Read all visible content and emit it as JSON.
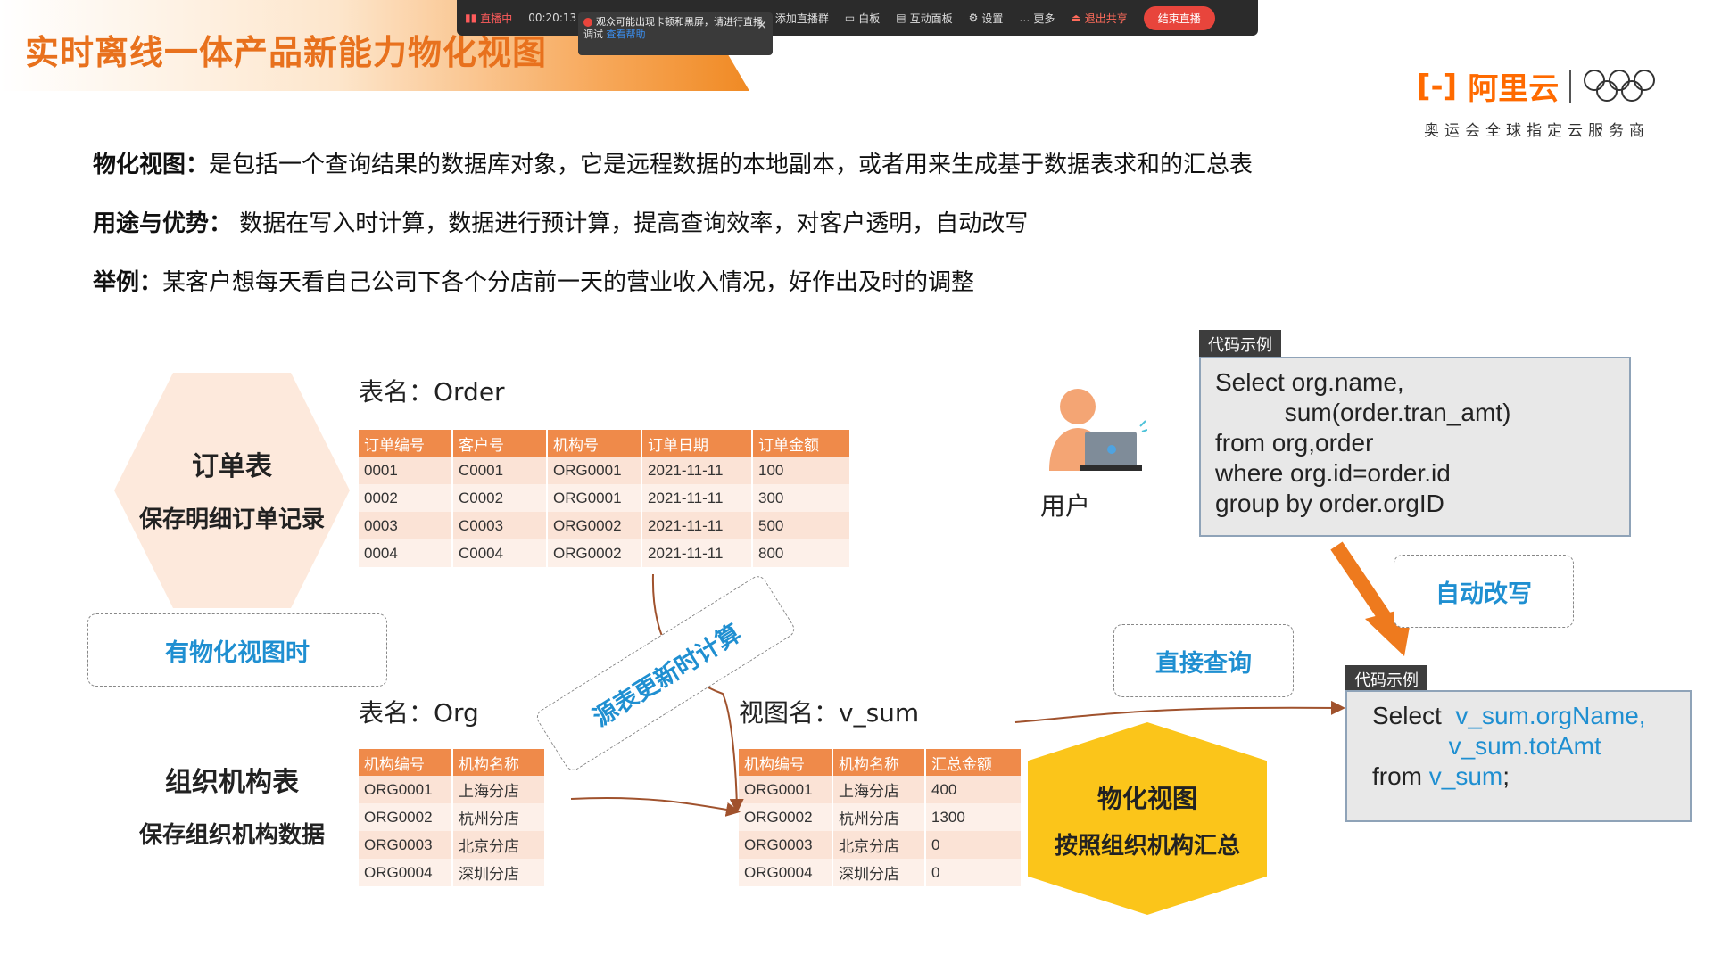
{
  "page": {
    "title": "实时离线一体产品新能力物化视图"
  },
  "toolbar": {
    "live_label": "直播中",
    "timer": "00:20:13",
    "items": [
      "添加直播群",
      "白板",
      "互动面板",
      "设置",
      "更多"
    ],
    "exit_share": "退出共享",
    "end_live": "结束直播"
  },
  "notice": {
    "text": "观众可能出现卡顿和黑屏，请进行直播调试",
    "link": "查看帮助"
  },
  "logo": {
    "brand": "阿里云",
    "mark": "[-]",
    "subtitle": "奥运会全球指定云服务商"
  },
  "intro": [
    {
      "label": "物化视图：",
      "text": "是包括一个查询结果的数据库对象，它是远程数据的本地副本，或者用来生成基于数据表求和的汇总表"
    },
    {
      "label": "用途与优势：",
      "text": " 数据在写入时计算，数据进行预计算，提高查询效率，对客户透明，自动改写"
    },
    {
      "label": "举例：",
      "text": "某客户想每天看自己公司下各个分店前一天的营业收入情况，好作出及时的调整"
    }
  ],
  "order_block": {
    "hex_title": "订单表",
    "hex_sub": "保存明细订单记录",
    "table_label": "表名：Order",
    "headers": [
      "订单编号",
      "客户号",
      "机构号",
      "订单日期",
      "订单金额"
    ],
    "rows": [
      [
        "0001",
        "C0001",
        "ORG0001",
        "2021-11-11",
        "100"
      ],
      [
        "0002",
        "C0002",
        "ORG0001",
        "2021-11-11",
        "300"
      ],
      [
        "0003",
        "C0003",
        "ORG0002",
        "2021-11-11",
        "500"
      ],
      [
        "0004",
        "C0004",
        "ORG0002",
        "2021-11-11",
        "800"
      ]
    ]
  },
  "org_block": {
    "title": "组织机构表",
    "sub": "保存组织机构数据",
    "table_label": "表名：Org",
    "headers": [
      "机构编号",
      "机构名称"
    ],
    "rows": [
      [
        "ORG0001",
        "上海分店"
      ],
      [
        "ORG0002",
        "杭州分店"
      ],
      [
        "ORG0003",
        "北京分店"
      ],
      [
        "ORG0004",
        "深圳分店"
      ]
    ]
  },
  "view_block": {
    "table_label": "视图名：v_sum",
    "headers": [
      "机构编号",
      "机构名称",
      "汇总金额"
    ],
    "rows": [
      [
        "ORG0001",
        "上海分店",
        "400"
      ],
      [
        "ORG0002",
        "杭州分店",
        "1300"
      ],
      [
        "ORG0003",
        "北京分店",
        "0"
      ],
      [
        "ORG0004",
        "深圳分店",
        "0"
      ]
    ]
  },
  "mv_hex": {
    "title": "物化视图",
    "sub": "按照组织机构汇总"
  },
  "callouts": {
    "has_mv": "有物化视图时",
    "source_update": "源表更新时计算",
    "direct_query": "直接查询",
    "auto_rewrite": "自动改写"
  },
  "user": {
    "label": "用户"
  },
  "code1": {
    "tag": "代码示例",
    "lines": [
      "Select org.name,",
      "          sum(order.tran_amt)",
      "from org,order",
      "where org.id=order.id",
      "group by order.orgID"
    ]
  },
  "code2": {
    "tag": "代码示例",
    "select": "Select",
    "field1": "v_sum.orgName,",
    "field2": "v_sum.totAmt",
    "from": "from",
    "table": "v_sum",
    "end": ";"
  },
  "colors": {
    "accent": "#e8711d",
    "table_header": "#ef8a4a",
    "link_blue": "#1f8fd1",
    "mv_yellow": "#fbc51a",
    "arrow": "#a0522d"
  }
}
